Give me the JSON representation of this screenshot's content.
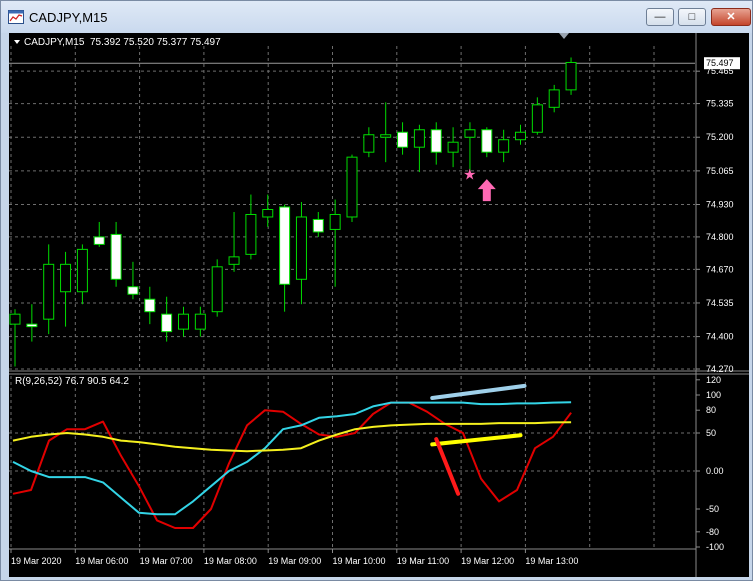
{
  "window": {
    "title": "CADJPY,M15",
    "minimize_glyph": "—",
    "maximize_glyph": "□",
    "close_glyph": "✕"
  },
  "colors": {
    "background": "#000000",
    "grid": "#6e6e6e",
    "candle_outline": "#00dd00",
    "bull_body": "#000000",
    "bear_body": "#ffffff",
    "text": "#ffffff",
    "current_price_box": "#ffffff",
    "star": "#ff69b4",
    "arrow": "#ff69b4",
    "series_red": "#e00000",
    "series_cyan": "#33d4e6",
    "series_yellow": "#f5f01e",
    "drawn_lightblue": "#9fd0ea",
    "drawn_red": "#ff1a1a",
    "drawn_yellow": "#ffff00"
  },
  "main_panel": {
    "header_symbol": "CADJPY,M15",
    "ohlc": "75.392 75.520 75.377 75.497",
    "current_price": "75.497",
    "price_ticks": [
      "75.465",
      "75.335",
      "75.200",
      "75.065",
      "74.930",
      "74.800",
      "74.670",
      "74.535",
      "74.400",
      "74.270"
    ],
    "price_min": 74.27,
    "price_max": 75.55
  },
  "indicator_panel": {
    "header": "R(9,26,52) 76.7 90.5 64.2",
    "ticks": [
      "120",
      "100",
      "80",
      "50",
      "0.00",
      "-50",
      "-80",
      "-100"
    ],
    "vmin": -100,
    "vmax": 125
  },
  "time_axis": {
    "labels": [
      "19 Mar 2020",
      "19 Mar 06:00",
      "19 Mar 07:00",
      "19 Mar 08:00",
      "19 Mar 09:00",
      "19 Mar 10:00",
      "19 Mar 11:00",
      "19 Mar 12:00",
      "19 Mar 13:00"
    ]
  },
  "candles": [
    {
      "o": 74.45,
      "h": 74.51,
      "l": 74.28,
      "c": 74.49
    },
    {
      "o": 74.45,
      "h": 74.53,
      "l": 74.38,
      "c": 74.44
    },
    {
      "o": 74.47,
      "h": 74.77,
      "l": 74.41,
      "c": 74.69
    },
    {
      "o": 74.58,
      "h": 74.74,
      "l": 74.44,
      "c": 74.69
    },
    {
      "o": 74.58,
      "h": 74.77,
      "l": 74.53,
      "c": 74.75
    },
    {
      "o": 74.8,
      "h": 74.86,
      "l": 74.76,
      "c": 74.77
    },
    {
      "o": 74.81,
      "h": 74.86,
      "l": 74.6,
      "c": 74.63
    },
    {
      "o": 74.6,
      "h": 74.7,
      "l": 74.55,
      "c": 74.57
    },
    {
      "o": 74.55,
      "h": 74.6,
      "l": 74.45,
      "c": 74.5
    },
    {
      "o": 74.49,
      "h": 74.56,
      "l": 74.38,
      "c": 74.42
    },
    {
      "o": 74.43,
      "h": 74.52,
      "l": 74.4,
      "c": 74.49
    },
    {
      "o": 74.43,
      "h": 74.52,
      "l": 74.4,
      "c": 74.49
    },
    {
      "o": 74.5,
      "h": 74.71,
      "l": 74.48,
      "c": 74.68
    },
    {
      "o": 74.69,
      "h": 74.9,
      "l": 74.66,
      "c": 74.72
    },
    {
      "o": 74.73,
      "h": 74.97,
      "l": 74.71,
      "c": 74.89
    },
    {
      "o": 74.88,
      "h": 74.97,
      "l": 74.84,
      "c": 74.91
    },
    {
      "o": 74.92,
      "h": 74.93,
      "l": 74.5,
      "c": 74.61
    },
    {
      "o": 74.63,
      "h": 74.94,
      "l": 74.53,
      "c": 74.88
    },
    {
      "o": 74.87,
      "h": 74.9,
      "l": 74.8,
      "c": 74.82
    },
    {
      "o": 74.83,
      "h": 74.95,
      "l": 74.6,
      "c": 74.89
    },
    {
      "o": 74.88,
      "h": 75.13,
      "l": 74.86,
      "c": 75.12
    },
    {
      "o": 75.14,
      "h": 75.24,
      "l": 75.12,
      "c": 75.21
    },
    {
      "o": 75.2,
      "h": 75.34,
      "l": 75.1,
      "c": 75.21
    },
    {
      "o": 75.22,
      "h": 75.26,
      "l": 75.13,
      "c": 75.16
    },
    {
      "o": 75.16,
      "h": 75.25,
      "l": 75.06,
      "c": 75.23
    },
    {
      "o": 75.23,
      "h": 75.26,
      "l": 75.09,
      "c": 75.14
    },
    {
      "o": 75.14,
      "h": 75.24,
      "l": 75.08,
      "c": 75.18
    },
    {
      "o": 75.2,
      "h": 75.26,
      "l": 75.06,
      "c": 75.23
    },
    {
      "o": 75.23,
      "h": 75.24,
      "l": 75.12,
      "c": 75.14
    },
    {
      "o": 75.14,
      "h": 75.23,
      "l": 75.1,
      "c": 75.19
    },
    {
      "o": 75.19,
      "h": 75.25,
      "l": 75.17,
      "c": 75.22
    },
    {
      "o": 75.22,
      "h": 75.36,
      "l": 75.21,
      "c": 75.33
    },
    {
      "o": 75.32,
      "h": 75.41,
      "l": 75.3,
      "c": 75.39
    },
    {
      "o": 75.39,
      "h": 75.52,
      "l": 75.37,
      "c": 75.5
    }
  ],
  "chart_data": {
    "type": "line",
    "series": [
      {
        "values": [
          -30,
          -25,
          40,
          55,
          55,
          65,
          20,
          -20,
          -65,
          -75,
          -75,
          -50,
          10,
          60,
          80,
          78,
          62,
          48,
          45,
          50,
          75,
          90,
          90,
          78,
          62,
          50,
          -10,
          -40,
          -25,
          30,
          45,
          76.7
        ]
      },
      {
        "values": [
          12,
          0,
          -8,
          -8,
          -8,
          -15,
          -35,
          -55,
          -57,
          -57,
          -40,
          -20,
          0,
          12,
          30,
          55,
          60,
          70,
          72,
          75,
          85,
          90,
          90,
          90,
          90,
          90,
          88,
          88,
          89,
          89,
          90,
          90.5
        ]
      },
      {
        "values": [
          40,
          45,
          48,
          50,
          48,
          45,
          40,
          38,
          35,
          32,
          30,
          28,
          27,
          26,
          27,
          28,
          30,
          40,
          48,
          55,
          58,
          60,
          61,
          62,
          62,
          62,
          62,
          63,
          63,
          63,
          64,
          64.2
        ]
      }
    ]
  },
  "annotations": {
    "star_glyph": "★",
    "arrow_glyph": "↑"
  }
}
